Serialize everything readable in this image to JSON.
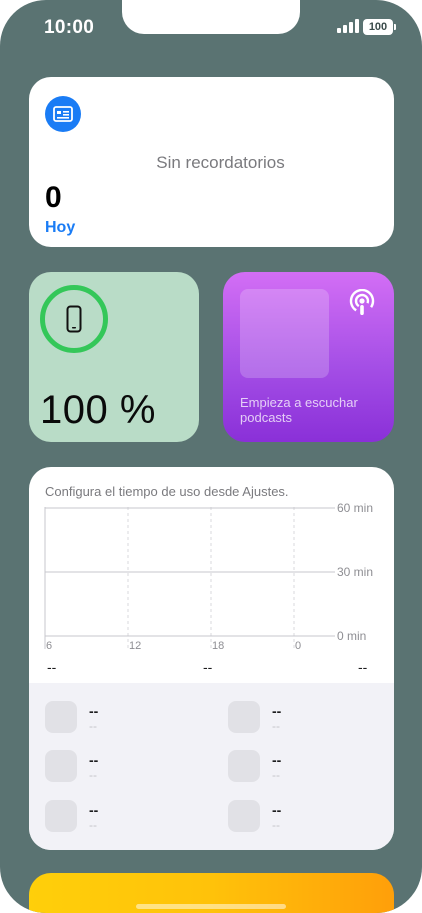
{
  "status_bar": {
    "time": "10:00",
    "battery_level": "100"
  },
  "reminders": {
    "empty_text": "Sin recordatorios",
    "count": "0",
    "today_label": "Hoy",
    "icon": "reminders-list-icon",
    "accent": "#1a7cf5"
  },
  "battery_widget": {
    "percent_label": "100 %",
    "level": 1.0,
    "icon": "iphone-icon",
    "ring_color": "#34c759"
  },
  "podcasts": {
    "prompt": "Empieza a escuchar podcasts",
    "icon": "podcasts-icon"
  },
  "screen_time": {
    "title": "Configura el tiempo de uso desde Ajustes.",
    "chart_data": {
      "type": "bar",
      "x_tick_labels": [
        "6",
        "12",
        "18",
        "0"
      ],
      "y_tick_labels": [
        "60 min",
        "30 min",
        "0 min"
      ],
      "ylim": [
        0,
        60
      ],
      "values": [],
      "grid": true
    },
    "summary": [
      "--",
      "--",
      "--"
    ],
    "apps": [
      {
        "name": "--",
        "time": "--"
      },
      {
        "name": "--",
        "time": "--"
      },
      {
        "name": "--",
        "time": "--"
      },
      {
        "name": "--",
        "time": "--"
      },
      {
        "name": "--",
        "time": "--"
      },
      {
        "name": "--",
        "time": "--"
      }
    ]
  }
}
